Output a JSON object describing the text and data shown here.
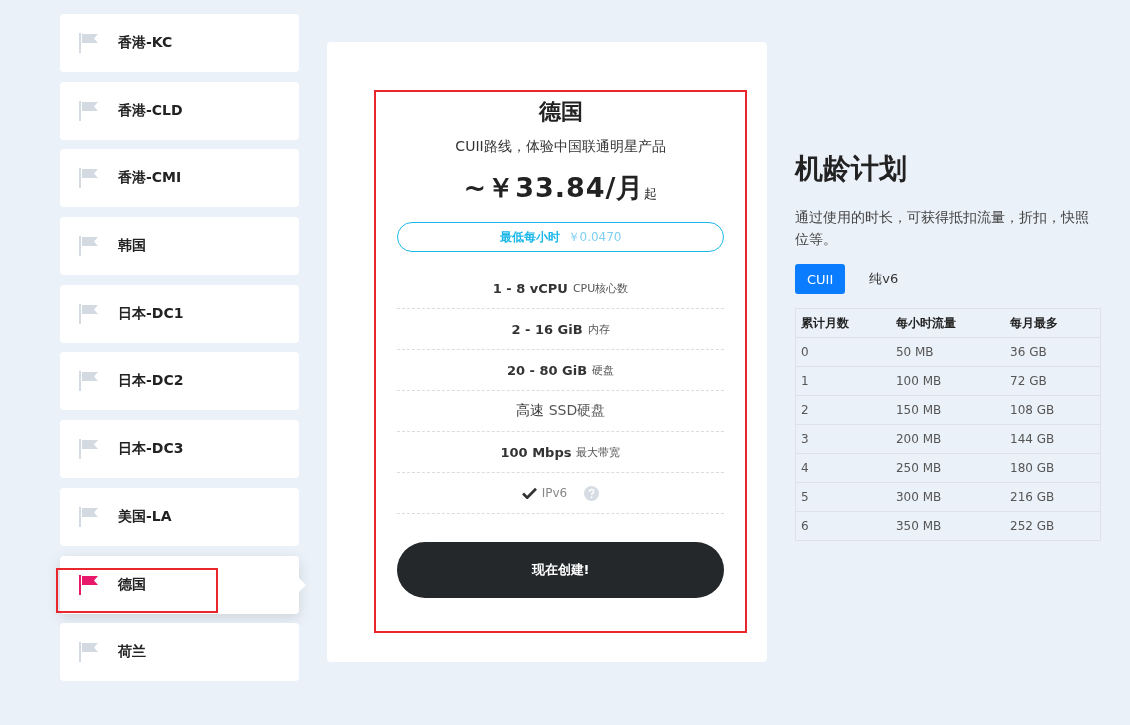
{
  "sidebar": {
    "items": [
      {
        "label": "香港-KC",
        "selected": false,
        "annotated": false
      },
      {
        "label": "香港-CLD",
        "selected": false,
        "annotated": false
      },
      {
        "label": "香港-CMI",
        "selected": false,
        "annotated": false
      },
      {
        "label": "韩国",
        "selected": false,
        "annotated": false
      },
      {
        "label": "日本-DC1",
        "selected": false,
        "annotated": false
      },
      {
        "label": "日本-DC2",
        "selected": false,
        "annotated": false
      },
      {
        "label": "日本-DC3",
        "selected": false,
        "annotated": false
      },
      {
        "label": "美国-LA",
        "selected": false,
        "annotated": false
      },
      {
        "label": "德国",
        "selected": true,
        "annotated": true
      },
      {
        "label": "荷兰",
        "selected": false,
        "annotated": false
      }
    ]
  },
  "plan": {
    "annotated": true,
    "title": "德国",
    "subtitle": "CUII路线，体验中国联通明星产品",
    "price": "~￥33.84/月",
    "price_suffix": "起",
    "hourly": {
      "label": "最低每小时",
      "value": "￥0.0470"
    },
    "features": [
      {
        "kind": "spec",
        "value": "1 - 8 vCPU",
        "unit": "CPU核心数"
      },
      {
        "kind": "spec",
        "value": "2 - 16 GiB",
        "unit": "内存"
      },
      {
        "kind": "spec",
        "value": "20 - 80 GiB",
        "unit": "硬盘"
      },
      {
        "kind": "large",
        "value": "高速",
        "unit": "SSD硬盘"
      },
      {
        "kind": "spec",
        "value": "100 Mbps",
        "unit": "最大带宽"
      },
      {
        "kind": "check",
        "value": "IPv6"
      }
    ],
    "button": "现在创建!"
  },
  "loyalty": {
    "title": "机龄计划",
    "description": "通过使用的时长，可获得抵扣流量，折扣，快照位等。",
    "tabs": [
      {
        "label": "CUII",
        "selected": true
      },
      {
        "label": "纯v6",
        "selected": false
      }
    ],
    "table": {
      "columns": [
        "累计月数",
        "每小时流量",
        "每月最多"
      ],
      "rows": [
        [
          "0",
          "50 MB",
          "36 GB"
        ],
        [
          "1",
          "100 MB",
          "72 GB"
        ],
        [
          "2",
          "150 MB",
          "108 GB"
        ],
        [
          "3",
          "200 MB",
          "144 GB"
        ],
        [
          "4",
          "250 MB",
          "180 GB"
        ],
        [
          "5",
          "300 MB",
          "216 GB"
        ],
        [
          "6",
          "350 MB",
          "252 GB"
        ]
      ]
    }
  }
}
